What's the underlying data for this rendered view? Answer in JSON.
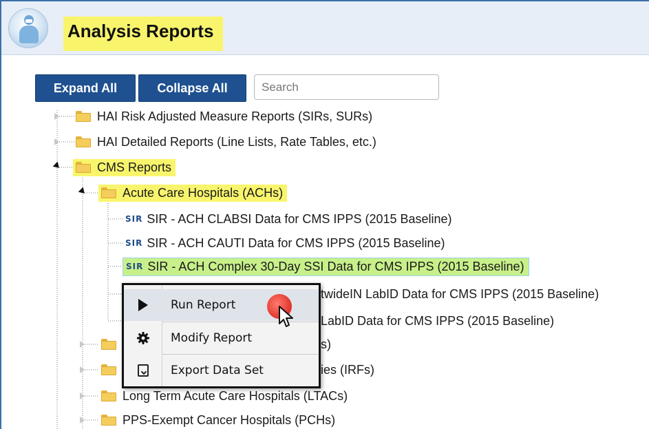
{
  "header": {
    "title": "Analysis Reports"
  },
  "toolbar": {
    "expand_label": "Expand All",
    "collapse_label": "Collapse All",
    "search_placeholder": "Search"
  },
  "tree": {
    "hai_risk": "HAI Risk Adjusted Measure Reports (SIRs, SURs)",
    "hai_detailed": "HAI Detailed Reports (Line Lists, Rate Tables, etc.)",
    "cms": "CMS Reports",
    "ach": "Acute Care Hospitals (ACHs)",
    "sir_badge": "SIR",
    "report_clabsi": "SIR - ACH CLABSI Data for CMS IPPS (2015 Baseline)",
    "report_cauti": "SIR - ACH CAUTI Data for CMS IPPS (2015 Baseline)",
    "report_ssi": "SIR - ACH Complex 30-Day SSI Data for CMS IPPS (2015 Baseline)",
    "report_mrsa_partial": "twideIN LabID Data for CMS IPPS (2015 Baseline)",
    "report_cdi_partial": "LabID Data for CMS IPPS (2015 Baseline)",
    "folder_a_partial": "s)",
    "folder_b_partial": "ies (IRFs)",
    "ltac": "Long Term Acute Care Hospitals (LTACs)",
    "pch": "PPS-Exempt Cancer Hospitals (PCHs)"
  },
  "context_menu": {
    "run": "Run Report",
    "modify": "Modify Report",
    "export": "Export Data Set"
  },
  "colors": {
    "highlight_yellow": "#f8f56d",
    "highlight_green": "#c8f08a",
    "button_blue": "#1f5191",
    "click_marker": "#e0342a"
  }
}
